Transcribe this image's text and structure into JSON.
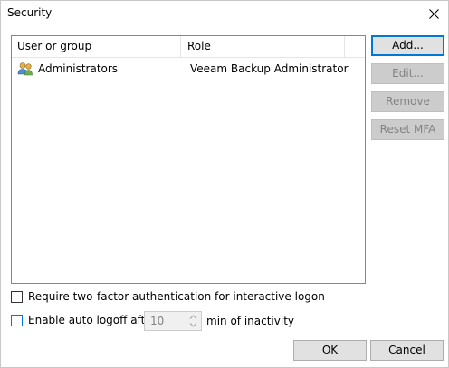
{
  "window": {
    "title": "Security"
  },
  "list": {
    "columns": [
      "User or group",
      "Role"
    ],
    "rows": [
      {
        "user": "Administrators",
        "role": "Veeam Backup Administrator",
        "icon": "users-group-icon"
      }
    ]
  },
  "side_buttons": {
    "add": "Add...",
    "edit": "Edit...",
    "remove": "Remove",
    "reset_mfa": "Reset MFA"
  },
  "options": {
    "two_factor_label": "Require two-factor authentication for interactive logon",
    "two_factor_checked": false,
    "auto_logoff_label": "Enable auto logoff after",
    "auto_logoff_checked": false,
    "auto_logoff_value": "10",
    "auto_logoff_suffix": "min of inactivity"
  },
  "footer": {
    "ok": "OK",
    "cancel": "Cancel"
  },
  "colors": {
    "accent": "#0078d7",
    "disabled_text": "#838383"
  }
}
